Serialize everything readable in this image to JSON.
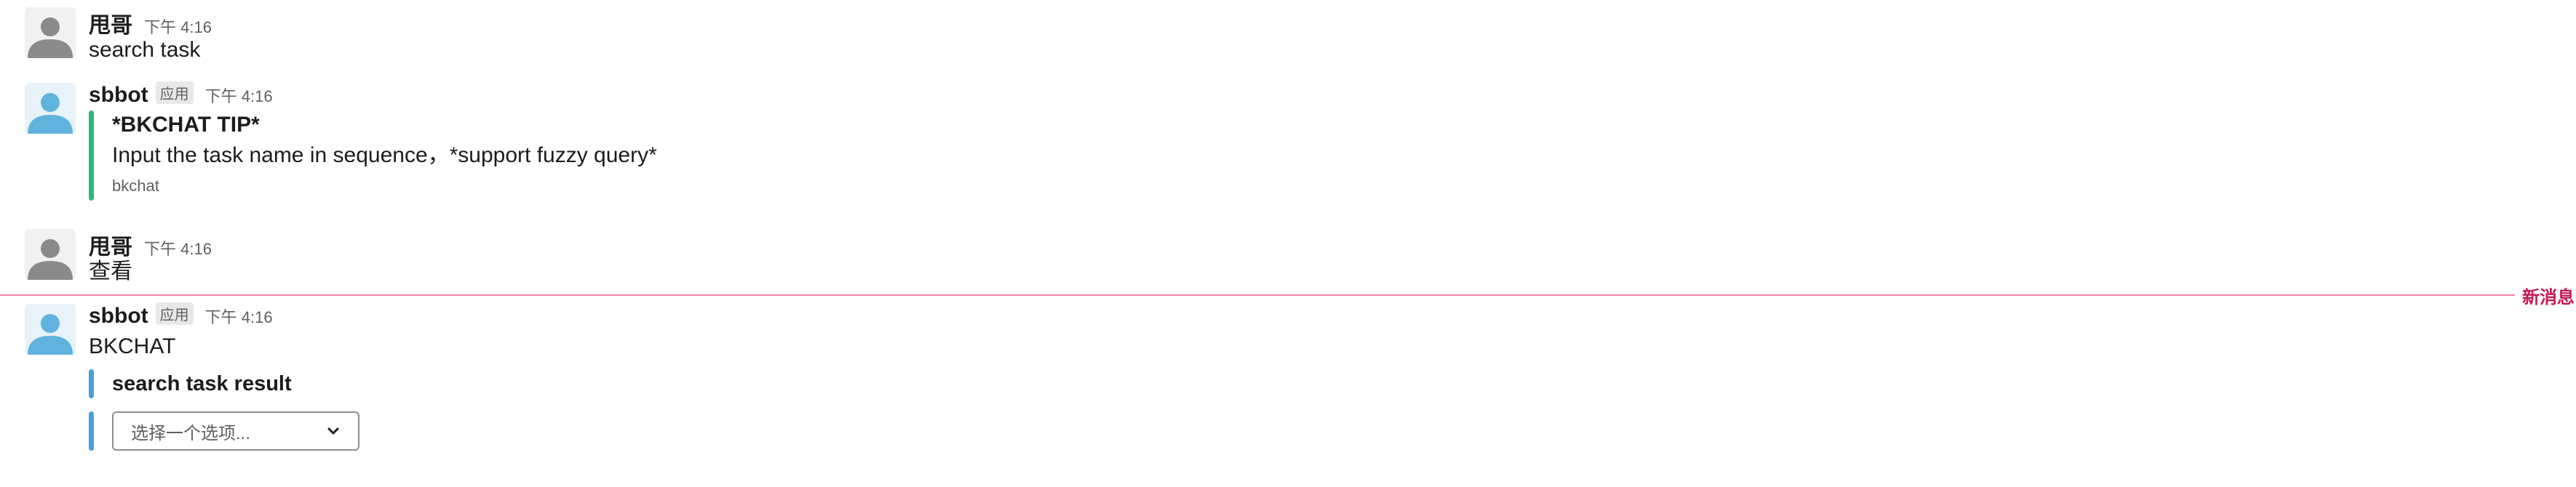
{
  "messages": [
    {
      "author": "甩哥",
      "time": "下午 4:16",
      "text": "search task"
    },
    {
      "author": "sbbot",
      "badge": "应用",
      "time": "下午 4:16",
      "attachment": {
        "color": "#2eb67d",
        "title": "*BKCHAT TIP*",
        "text": "Input the task name in sequence，*support fuzzy query*",
        "footer": "bkchat"
      }
    },
    {
      "author": "甩哥",
      "time": "下午 4:16",
      "text": "查看"
    },
    {
      "author": "sbbot",
      "badge": "应用",
      "time": "下午 4:16",
      "text": "BKCHAT",
      "attachment_title": "search task result",
      "attachment_color": "#4a9fd8",
      "select": {
        "placeholder": "选择一个选项..."
      }
    }
  ],
  "divider": {
    "label": "新消息",
    "color": "#e01e5a"
  },
  "icons": {
    "human_avatar": "person-gray-icon",
    "bot_avatar": "person-blue-icon",
    "select": "chevron-down-icon"
  }
}
